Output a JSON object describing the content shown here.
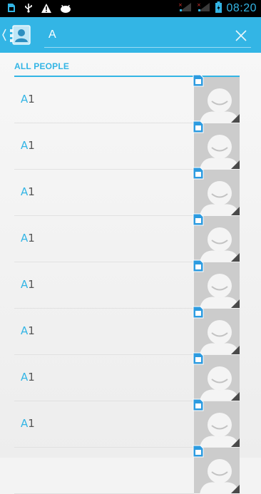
{
  "status_bar": {
    "time": "08:20",
    "icons": [
      "sim-card-icon",
      "usb-icon",
      "warning-icon",
      "android-debug-icon",
      "signal-1-icon",
      "signal-2-icon",
      "battery-icon"
    ],
    "accent_color": "#33b5e5"
  },
  "action_bar": {
    "background_color": "#33b5e5",
    "search": {
      "value": "A",
      "placeholder": ""
    },
    "icons": [
      "up-caret-icon",
      "contacts-app-icon",
      "close-icon"
    ]
  },
  "section": {
    "header": "ALL PEOPLE"
  },
  "contacts": [
    {
      "match": "A",
      "rest": "1",
      "avatar": "default-contact-icon",
      "badge": "sim-card-icon"
    },
    {
      "match": "A",
      "rest": "1",
      "avatar": "default-contact-icon",
      "badge": "sim-card-icon"
    },
    {
      "match": "A",
      "rest": "1",
      "avatar": "default-contact-icon",
      "badge": "sim-card-icon"
    },
    {
      "match": "A",
      "rest": "1",
      "avatar": "default-contact-icon",
      "badge": "sim-card-icon"
    },
    {
      "match": "A",
      "rest": "1",
      "avatar": "default-contact-icon",
      "badge": "sim-card-icon"
    },
    {
      "match": "A",
      "rest": "1",
      "avatar": "default-contact-icon",
      "badge": "sim-card-icon"
    },
    {
      "match": "A",
      "rest": "1",
      "avatar": "default-contact-icon",
      "badge": "sim-card-icon"
    },
    {
      "match": "A",
      "rest": "1",
      "avatar": "default-contact-icon",
      "badge": "sim-card-icon"
    },
    {
      "match": "",
      "rest": "",
      "avatar": "default-contact-icon",
      "badge": "sim-card-icon"
    }
  ]
}
